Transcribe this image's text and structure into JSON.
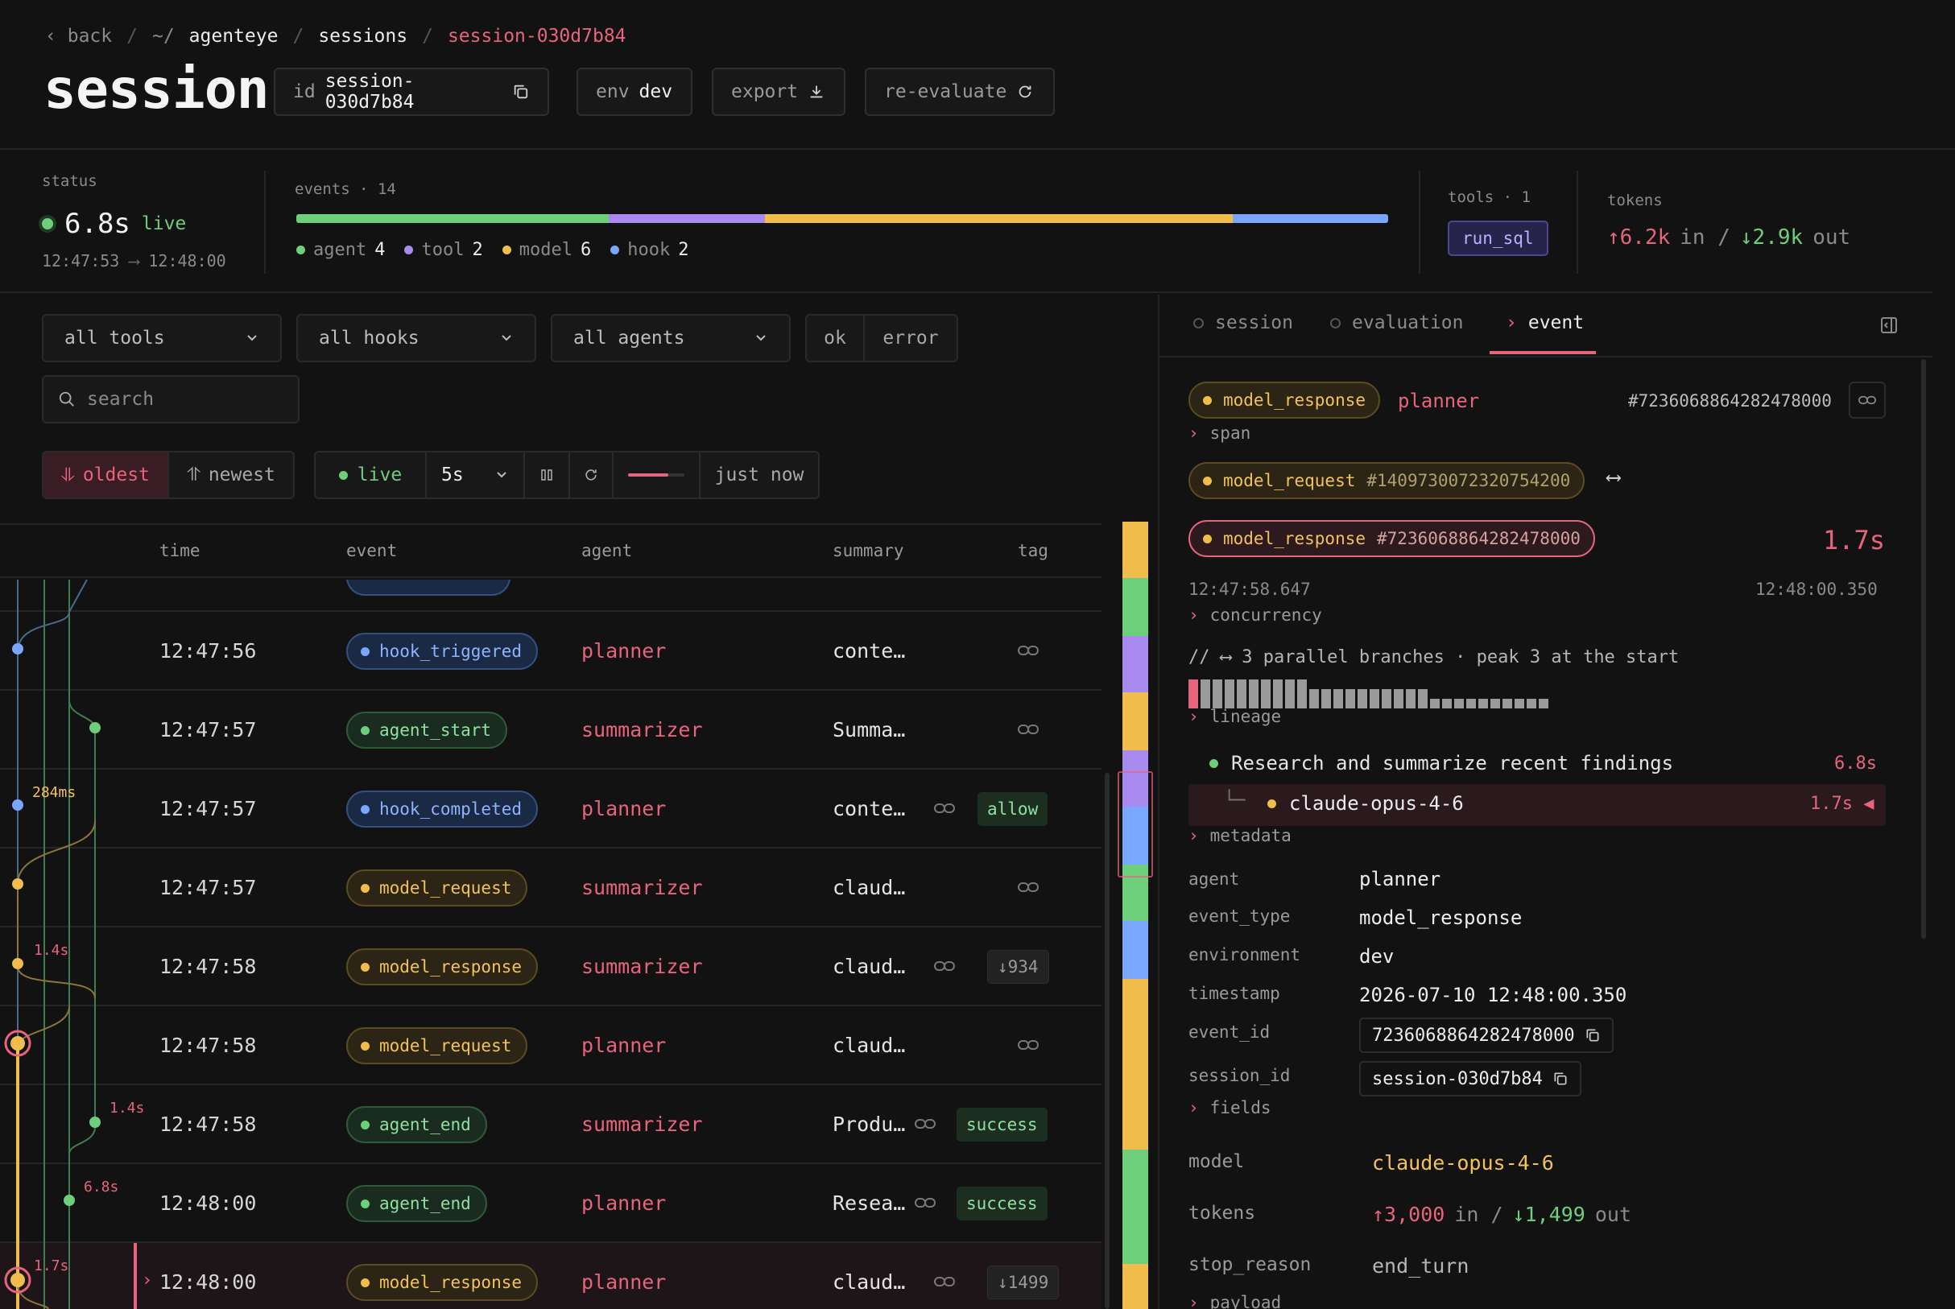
{
  "breadcrumb": {
    "back": "back",
    "home": "~/",
    "project": "agenteye",
    "sessions": "sessions",
    "current": "session-030d7b84"
  },
  "page_title": "session",
  "header_buttons": {
    "id_label": "id",
    "id_value": "session-030d7b84",
    "env_label": "env",
    "env_value": "dev",
    "export": "export",
    "reevaluate": "re-evaluate"
  },
  "status": {
    "label": "status",
    "duration": "6.8s",
    "live": "live",
    "start": "12:47:53",
    "arrow": "⟶",
    "end": "12:48:00"
  },
  "events": {
    "label": "events · 14",
    "segments": [
      {
        "name": "agent",
        "fraction": 0.286,
        "color": "#6ecf7a"
      },
      {
        "name": "tool",
        "fraction": 0.143,
        "color": "#a98bf0"
      },
      {
        "name": "model",
        "fraction": 0.429,
        "color": "#f0bd4c"
      },
      {
        "name": "hook",
        "fraction": 0.142,
        "color": "#7aa6ff"
      }
    ],
    "legend": [
      {
        "name": "agent",
        "count": "4",
        "color": "#6ecf7a"
      },
      {
        "name": "tool",
        "count": "2",
        "color": "#a98bf0"
      },
      {
        "name": "model",
        "count": "6",
        "color": "#f0bd4c"
      },
      {
        "name": "hook",
        "count": "2",
        "color": "#7aa6ff"
      }
    ]
  },
  "tools": {
    "label": "tools · 1",
    "item": "run_sql"
  },
  "tokens": {
    "label": "tokens",
    "in": "↑6.2k",
    "in_label": "in /",
    "out": "↓2.9k",
    "out_label": "out"
  },
  "filters": {
    "tools": "all tools",
    "hooks": "all hooks",
    "agents": "all agents",
    "ok": "ok",
    "error": "error",
    "search_placeholder": "search"
  },
  "sort": {
    "oldest": "oldest",
    "newest": "newest"
  },
  "live_controls": {
    "live": "live",
    "interval": "5s",
    "updated": "just now"
  },
  "table": {
    "columns": {
      "time": "time",
      "event": "event",
      "agent": "agent",
      "summary": "summary",
      "tag": "tag"
    },
    "rows": [
      {
        "time": "12:47:56",
        "event": "hook_triggered",
        "kind": "blue",
        "agent": "planner",
        "summary": "conte…",
        "tag": ""
      },
      {
        "time": "12:47:57",
        "event": "agent_start",
        "kind": "green",
        "agent": "summarizer",
        "summary": "Summa…",
        "tag": ""
      },
      {
        "time": "12:47:57",
        "event": "hook_completed",
        "kind": "blue",
        "agent": "planner",
        "summary": "conte…",
        "tag": "allow"
      },
      {
        "time": "12:47:57",
        "event": "model_request",
        "kind": "yellow",
        "agent": "summarizer",
        "summary": "claud…",
        "tag": ""
      },
      {
        "time": "12:47:58",
        "event": "model_response",
        "kind": "yellow",
        "agent": "summarizer",
        "summary": "claud…",
        "tag": "↓934"
      },
      {
        "time": "12:47:58",
        "event": "model_request",
        "kind": "yellow",
        "agent": "planner",
        "summary": "claud…",
        "tag": ""
      },
      {
        "time": "12:47:58",
        "event": "agent_end",
        "kind": "green",
        "agent": "summarizer",
        "summary": "Produ…",
        "tag": "success"
      },
      {
        "time": "12:48:00",
        "event": "agent_end",
        "kind": "green",
        "agent": "planner",
        "summary": "Resea…",
        "tag": "success"
      },
      {
        "time": "12:48:00",
        "event": "model_response",
        "kind": "yellow",
        "agent": "planner",
        "summary": "claud…",
        "tag": "↓1499"
      }
    ],
    "graph_labels": {
      "l284": "284ms",
      "l14a": "1.4s",
      "l14b": "1.4s",
      "l68": "6.8s",
      "l17": "1.7s"
    }
  },
  "panel": {
    "tabs": {
      "session": "session",
      "evaluation": "evaluation",
      "event": "event"
    },
    "head_event": "model_response",
    "head_agent": "planner",
    "head_id": "#7236068864282478000",
    "span_label": "span",
    "span_request": "model_request",
    "span_request_id": "#1409730072320754200",
    "span_response": "model_response",
    "span_response_id": "#7236068864282478000",
    "span_duration": "1.7s",
    "span_start": "12:47:58.647",
    "span_end": "12:48:00.350",
    "concurrency_label": "concurrency",
    "concurrency_text": "// ⟷ 3 parallel branches · peak 3 at the start",
    "lineage_label": "lineage",
    "lineage_root": "Research and summarize recent findings",
    "lineage_root_dur": "6.8s",
    "lineage_child": "claude-opus-4-6",
    "lineage_child_dur": "1.7s ◀",
    "metadata_label": "metadata",
    "metadata": {
      "agent_k": "agent",
      "agent_v": "planner",
      "event_type_k": "event_type",
      "event_type_v": "model_response",
      "environment_k": "environment",
      "environment_v": "dev",
      "timestamp_k": "timestamp",
      "timestamp_v": "2026-07-10 12:48:00.350",
      "event_id_k": "event_id",
      "event_id_v": "7236068864282478000",
      "session_id_k": "session_id",
      "session_id_v": "session-030d7b84"
    },
    "fields_label": "fields",
    "fields": {
      "model_k": "model",
      "model_v": "claude-opus-4-6",
      "tokens_k": "tokens",
      "tokens_in": "↑3,000",
      "tokens_in_label": "in /",
      "tokens_out": "↓1,499",
      "tokens_out_label": "out",
      "stop_reason_k": "stop_reason",
      "stop_reason_v": "end_turn"
    },
    "payload_label": "payload"
  }
}
